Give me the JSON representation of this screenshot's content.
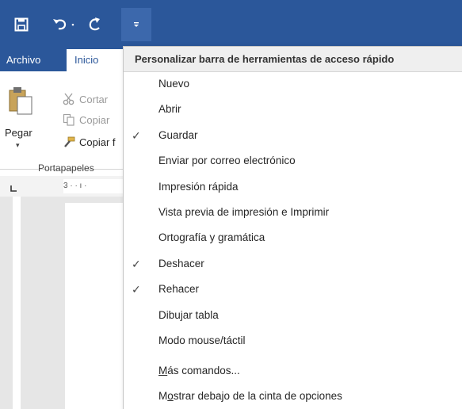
{
  "window": {
    "tabs": {
      "file": "Archivo",
      "home": "Inicio"
    }
  },
  "quick_access": {
    "icons": [
      "save-icon",
      "undo-icon",
      "redo-icon",
      "customize-dropdown-icon"
    ]
  },
  "ribbon": {
    "clipboard": {
      "paste_label": "Pegar",
      "cut_label": "Cortar",
      "copy_label": "Copiar",
      "format_painter_label": "Copiar f",
      "group_label": "Portapapeles"
    }
  },
  "ruler": {
    "text": "3 · · ı ·"
  },
  "menu": {
    "title": "Personalizar barra de herramientas de acceso rápido",
    "items": [
      {
        "label": "Nuevo",
        "checked": false
      },
      {
        "label": "Abrir",
        "checked": false
      },
      {
        "label": "Guardar",
        "checked": true
      },
      {
        "label": "Enviar por correo electrónico",
        "checked": false
      },
      {
        "label": "Impresión rápida",
        "checked": false
      },
      {
        "label": "Vista previa de impresión e Imprimir",
        "checked": false
      },
      {
        "label": "Ortografía y gramática",
        "checked": false
      },
      {
        "label": "Deshacer",
        "checked": true
      },
      {
        "label": "Rehacer",
        "checked": true
      },
      {
        "label": "Dibujar tabla",
        "checked": false
      },
      {
        "label": "Modo mouse/táctil",
        "checked": false
      }
    ],
    "more_commands": {
      "underlined": "M",
      "rest": "ás comandos..."
    },
    "show_below": {
      "before": "M",
      "underlined": "o",
      "rest": "strar debajo de la cinta de opciones"
    },
    "check_glyph": "✓"
  },
  "colors": {
    "title_bar": "#2b579a",
    "menu_header_bg": "#efefef"
  }
}
